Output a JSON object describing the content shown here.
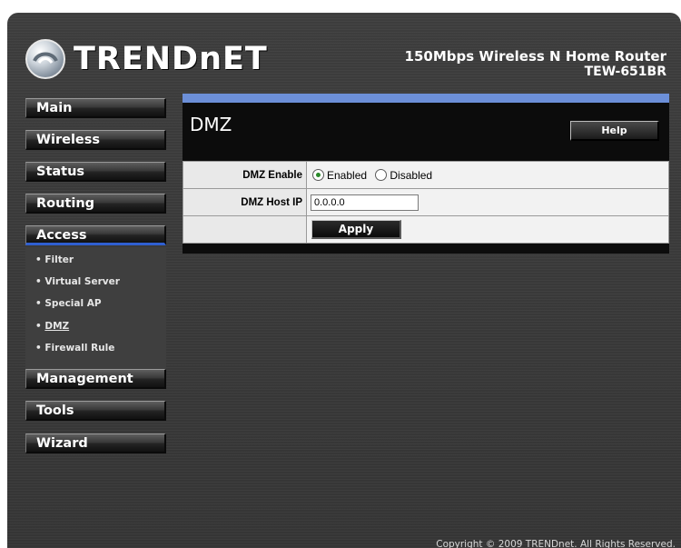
{
  "header": {
    "brand": "TRENDnET",
    "product_line1": "150Mbps Wireless N Home Router",
    "product_line2": "TEW-651BR"
  },
  "nav": {
    "main": "Main",
    "wireless": "Wireless",
    "status": "Status",
    "routing": "Routing",
    "access": "Access",
    "management": "Management",
    "tools": "Tools",
    "wizard": "Wizard"
  },
  "submenu": [
    {
      "label": "Filter"
    },
    {
      "label": "Virtual Server"
    },
    {
      "label": "Special AP"
    },
    {
      "label": "DMZ"
    },
    {
      "label": "Firewall Rule"
    }
  ],
  "content": {
    "title": "DMZ",
    "help_label": "Help",
    "dmz_enable_label": "DMZ Enable",
    "enabled_label": "Enabled",
    "disabled_label": "Disabled",
    "dmz_enabled": true,
    "host_ip_label": "DMZ Host IP",
    "host_ip_value": "0.0.0.0",
    "apply_label": "Apply"
  },
  "footer": {
    "copyright": "Copyright © 2009 TRENDnet. All Rights Reserved."
  },
  "colors": {
    "accent_blue": "#2f5fd0",
    "panel_top_bar": "#6c8fd8",
    "radio_checked": "#2a8a2a"
  }
}
